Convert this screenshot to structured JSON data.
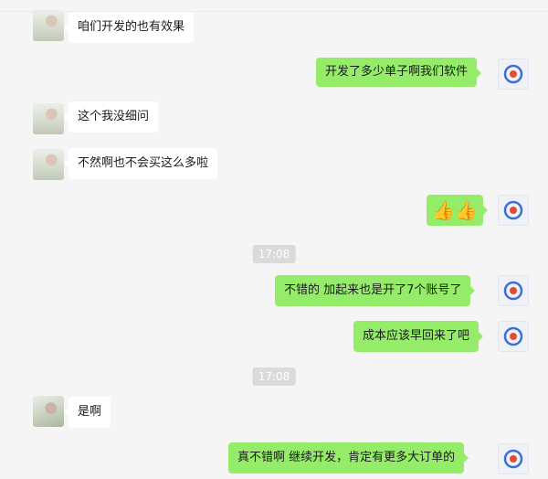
{
  "chat": {
    "messages": [
      {
        "side": "in",
        "text": "咱们开发的也有效果"
      },
      {
        "side": "out",
        "text": "开发了多少单子啊我们软件"
      },
      {
        "side": "in",
        "text": "这个我没细问"
      },
      {
        "side": "in",
        "text": "不然啊也不会买这么多啦"
      },
      {
        "side": "out",
        "text": "👍👍"
      },
      {
        "side": "out",
        "text": "不错的  加起来也是开了7个账号了"
      },
      {
        "side": "out",
        "text": "成本应该早回来了吧"
      },
      {
        "side": "in",
        "text": "是啊"
      },
      {
        "side": "out",
        "text": "真不错啊   继续开发，肯定有更多大订单的"
      }
    ],
    "timestamps": [
      "17:08",
      "17:08"
    ]
  },
  "colors": {
    "background": "#f5f5f5",
    "bubble_out": "#95ec69",
    "bubble_in": "#ffffff",
    "time_badge": "#dadada"
  },
  "icons": {
    "contact_avatar": "blurred-photo-avatar",
    "self_avatar": "blue-ring-logo-avatar"
  }
}
